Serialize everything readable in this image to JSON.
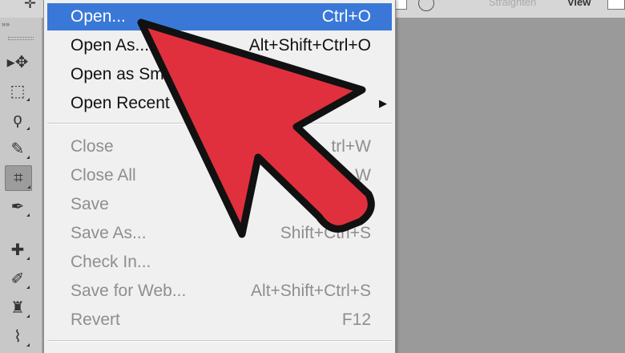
{
  "menu": {
    "items": [
      {
        "label": "Open...",
        "shortcut": "Ctrl+O",
        "highlight": true
      },
      {
        "label": "Open As...",
        "shortcut": "Alt+Shift+Ctrl+O"
      },
      {
        "label": "Open as Sm",
        "shortcut": ""
      },
      {
        "label": "Open Recent",
        "shortcut": "",
        "submenu": true
      },
      {
        "label": "Close",
        "shortcut": "trl+W",
        "disabled": true
      },
      {
        "label": "Close All",
        "shortcut": "W",
        "disabled": true
      },
      {
        "label": "Save",
        "shortcut": "",
        "disabled": true
      },
      {
        "label": "Save As...",
        "shortcut": "Shift+Ctrl+S",
        "disabled": true
      },
      {
        "label": "Check In...",
        "shortcut": "",
        "disabled": true
      },
      {
        "label": "Save for Web...",
        "shortcut": "Alt+Shift+Ctrl+S",
        "disabled": true
      },
      {
        "label": "Revert",
        "shortcut": "F12",
        "disabled": true
      }
    ]
  },
  "toolbar": {
    "collapse_glyph": "»»",
    "tools": [
      {
        "icon": "move-tool-icon",
        "glyph": "▸✥"
      },
      {
        "icon": "marquee-tool-icon",
        "glyph": "⬚"
      },
      {
        "icon": "lasso-tool-icon",
        "glyph": "ϙ"
      },
      {
        "icon": "quick-selection-tool-icon",
        "glyph": "✎"
      },
      {
        "icon": "crop-tool-icon",
        "glyph": "⌗",
        "active": true
      },
      {
        "icon": "eyedropper-tool-icon",
        "glyph": "✒"
      },
      {
        "icon": "healing-brush-tool-icon",
        "glyph": "✚"
      },
      {
        "icon": "brush-tool-icon",
        "glyph": "✐"
      },
      {
        "icon": "clone-stamp-tool-icon",
        "glyph": "♜"
      },
      {
        "icon": "history-brush-tool-icon",
        "glyph": "⌇"
      }
    ]
  },
  "options_bar": {
    "partial_text": "Straighten",
    "view_label": "View"
  },
  "colors": {
    "highlight": "#3a78d8",
    "arrow_fill": "#e0303e",
    "menu_bg": "#f0f0f0",
    "disabled_text": "#8e8e8e"
  }
}
